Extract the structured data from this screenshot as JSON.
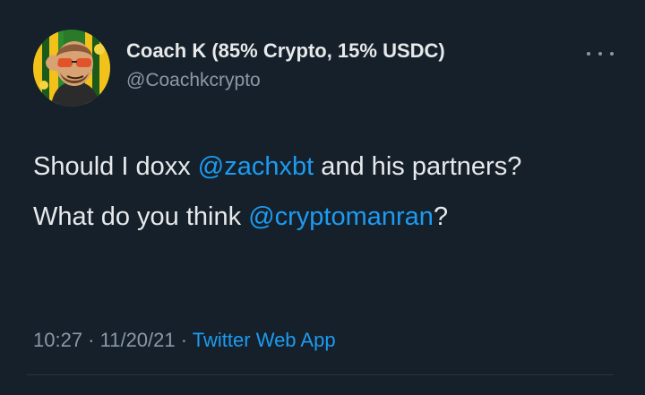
{
  "author": {
    "display_name": "Coach K (85% Crypto, 15% USDC)",
    "handle": "@Coachkcrypto"
  },
  "tweet": {
    "line1_prefix": "Should I doxx ",
    "line1_mention": "@zachxbt",
    "line1_suffix": " and his partners?",
    "line2_prefix": "What do you think ",
    "line2_mention": "@cryptomanran",
    "line2_suffix": "?"
  },
  "meta": {
    "time": "10:27",
    "separator": " · ",
    "date": "11/20/21",
    "source": "Twitter Web App"
  },
  "icons": {
    "more": "more-horizontal-icon",
    "avatar": "cartoon-avatar-with-sunglasses"
  },
  "colors": {
    "background": "#15202b",
    "text": "#e7e9ea",
    "muted": "#8b98a5",
    "link": "#1d9bf0"
  }
}
